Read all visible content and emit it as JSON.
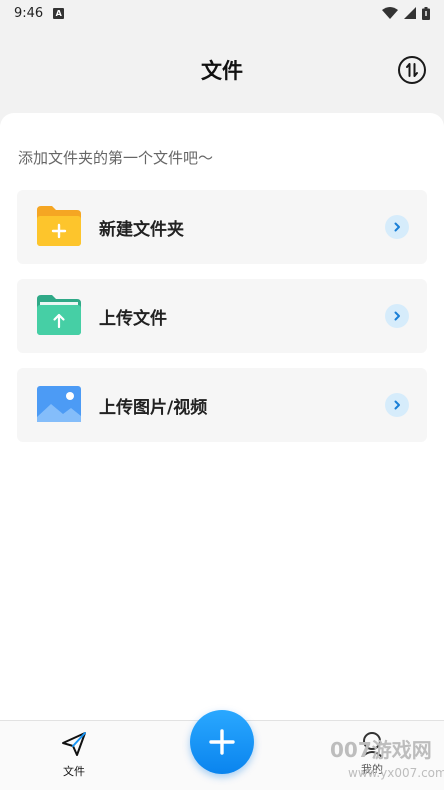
{
  "status": {
    "time": "9:46",
    "notif_icon": "a-badge-icon"
  },
  "header": {
    "title": "文件",
    "sort_icon": "sort-icon"
  },
  "main": {
    "hint": "添加文件夹的第一个文件吧～",
    "actions": [
      {
        "label": "新建文件夹",
        "icon": "new-folder-icon",
        "color": "#f7b51b"
      },
      {
        "label": "上传文件",
        "icon": "upload-file-icon",
        "color": "#3fc39e"
      },
      {
        "label": "上传图片/视频",
        "icon": "upload-image-icon",
        "color": "#4c9bf5"
      }
    ]
  },
  "tabbar": {
    "files_label": "文件",
    "mine_label": "我的",
    "add_icon": "plus-icon"
  },
  "watermark": {
    "text": "007游戏网",
    "sub": "www.yx007.com"
  },
  "colors": {
    "accent": "#1a96f5",
    "background": "#f2f2f2"
  }
}
